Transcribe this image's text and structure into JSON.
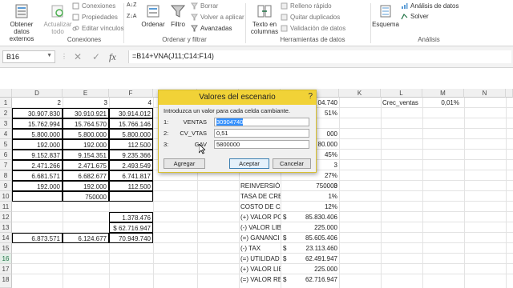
{
  "ribbon": {
    "obtener": "Obtener datos externos",
    "actualizar": "Actualizar todo",
    "conexiones": "Conexiones",
    "propiedades": "Propiedades",
    "editar_vinculos": "Editar vínculos",
    "grp_conexiones": "Conexiones",
    "ordenar_az": "A↓Z",
    "ordenar": "Ordenar",
    "filtro": "Filtro",
    "borrar": "Borrar",
    "volver": "Volver a aplicar",
    "avanzadas": "Avanzadas",
    "grp_ordenar": "Ordenar y filtrar",
    "texto_columnas": "Texto en columnas",
    "relleno": "Relleno rápido",
    "quitar": "Quitar duplicados",
    "validacion": "Validación de datos",
    "grp_herramientas": "Herramientas de datos",
    "esquema": "Esquema",
    "analisis_datos": "Análisis de datos",
    "solver": "Solver",
    "grp_analisis": "Análisis"
  },
  "formula_bar": {
    "name_box": "B16",
    "formula": "=B14+VNA(J11;C14:F14)",
    "fx": "fx"
  },
  "columns": [
    "D",
    "E",
    "F",
    "G",
    "H",
    "I",
    "J",
    "K",
    "L",
    "M",
    "N"
  ],
  "rows": [
    "1",
    "2",
    "3",
    "4",
    "5",
    "6",
    "7",
    "8",
    "9",
    "10",
    "11",
    "12",
    "13",
    "14",
    "15",
    "16",
    "17",
    "18"
  ],
  "cells": {
    "d1": "2",
    "e1": "3",
    "f1": "4",
    "d2": "30.907.830",
    "e2": "30.910.921",
    "f2": "30.914.012",
    "d3": "15.762.994",
    "e3": "15.764.570",
    "f3": "15.766.146",
    "d4": "5.800.000",
    "e4": "5.800.000",
    "f4": "5.800.000",
    "d5": "192.000",
    "e5": "192.000",
    "f5": "112.500",
    "d6": "9.152.837",
    "e6": "9.154.351",
    "f6": "9.235.366",
    "d7": "2.471.266",
    "e7": "2.471.675",
    "f7": "2.493.549",
    "d8": "6.681.571",
    "e8": "6.682.677",
    "f8": "6.741.817",
    "d9": "192.000",
    "e9": "192.000",
    "f9": "112.500",
    "e10": "750000",
    "f12": "1.378.476",
    "f13": "$ 62.716.947",
    "d14": "6.873.571",
    "e14": "6.124.677",
    "f14": "70.949.740",
    "j1": "04.740",
    "j2": "51%",
    "j4": "000",
    "j5": "80.000",
    "j6": "45%",
    "j7": "3",
    "j8": "27%",
    "j9": "3",
    "i10": "REINVERSIÓN",
    "j10": "750000",
    "i11": "TASA DE CREC",
    "j11": "1%",
    "i12": "COSTO DE CA",
    "j12": "12%",
    "i13": "(+) VALOR PC",
    "j13": "85.830.406",
    "i14": "(-) VALOR LIB",
    "j14": "225.000",
    "i15": "(=) GANANCI",
    "j15": "85.605.406",
    "i16": "(-) TAX",
    "j16": "23.113.460",
    "i17": "(=) UTILIDAD",
    "j17": "62.491.947",
    "i18": "(+) VALOR LIE",
    "j18": "225.000",
    "i19": "(=) VALOR RE",
    "j19": "62.716.947",
    "dollar": "$",
    "l1": "Crec_ventas",
    "m1": "0,01%"
  },
  "dialog": {
    "title": "Valores del escenario",
    "close": "?",
    "intro": "Introduzca un valor para cada celda cambiante.",
    "fields": [
      {
        "num": "1:",
        "label": "VENTAS",
        "value": "30904740"
      },
      {
        "num": "2:",
        "label": "CV_VTAS",
        "value": "0,51"
      },
      {
        "num": "3:",
        "label": "GAV",
        "value": "5800000"
      }
    ],
    "btn_agregar": "Agregar",
    "btn_aceptar": "Aceptar",
    "btn_cancelar": "Cancelar"
  },
  "colors": {
    "excel_green": "#217346",
    "dialog_title": "#f1d237",
    "selection": "#3390ff"
  }
}
